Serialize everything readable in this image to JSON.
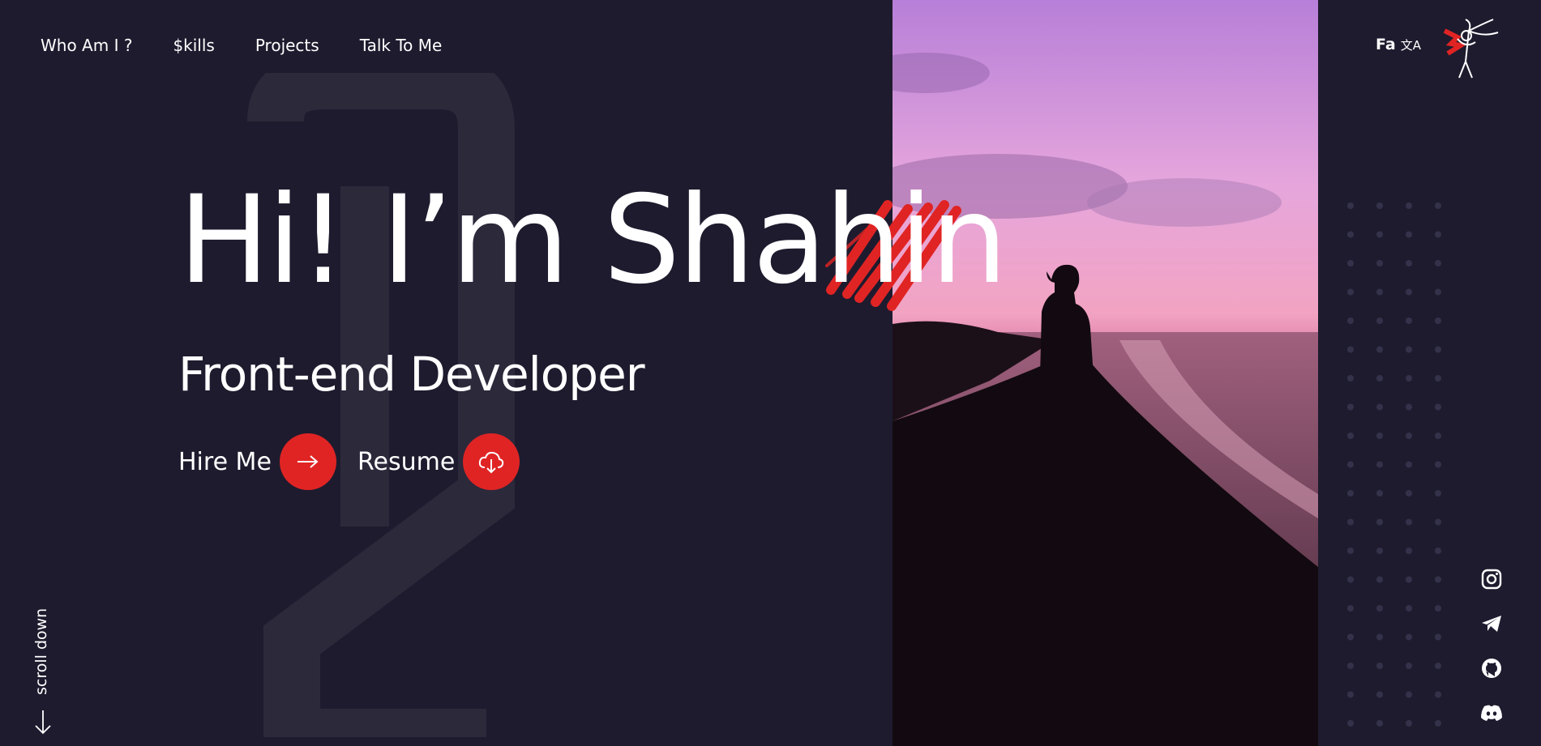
{
  "nav": {
    "items": [
      "Who Am I ?",
      "$kills",
      "Projects",
      "Talk To Me"
    ]
  },
  "language": {
    "label": "Fa",
    "icon": "translate-icon"
  },
  "hero": {
    "title": "Hi! I’m Shahin",
    "subtitle": "Front-end Developer"
  },
  "actions": {
    "hire_label": "Hire Me",
    "resume_label": "Resume"
  },
  "scroll": {
    "label": "scroll down"
  },
  "socials": [
    "instagram-icon",
    "telegram-icon",
    "github-icon",
    "discord-icon"
  ],
  "colors": {
    "background": "#1e1b2e",
    "accent": "#e02424",
    "text": "#ffffff"
  }
}
